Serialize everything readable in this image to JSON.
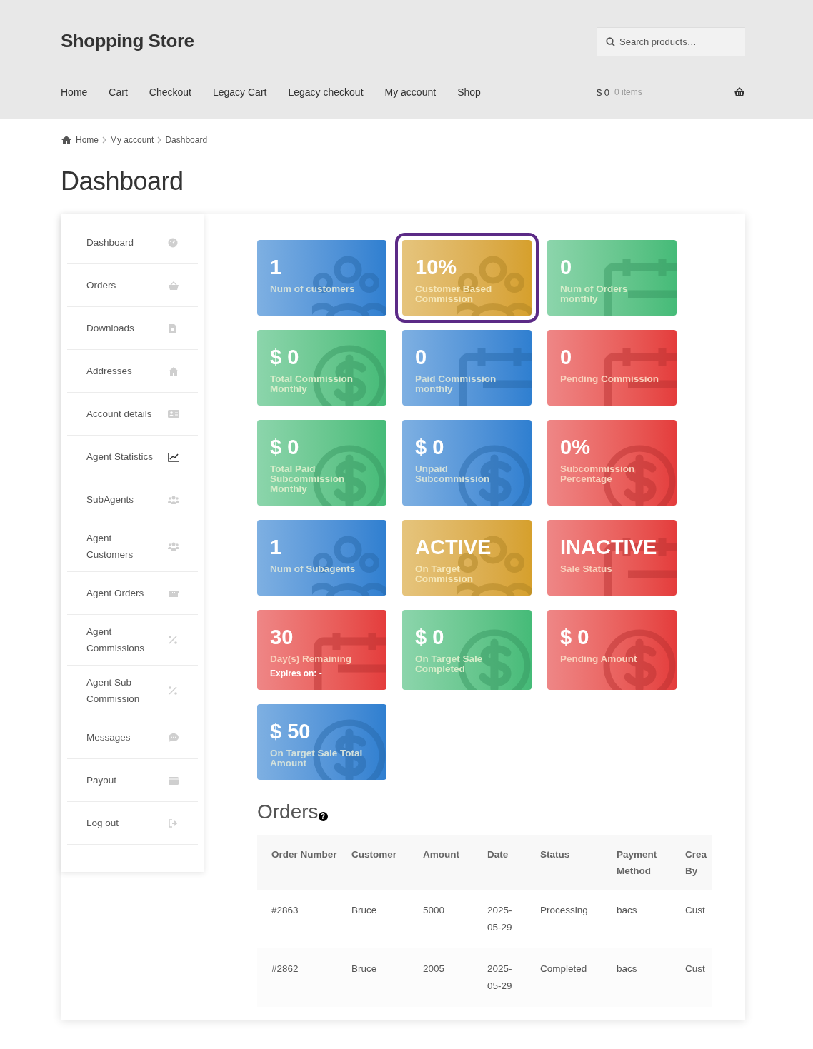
{
  "header": {
    "site_title": "Shopping Store",
    "search": {
      "placeholder": "Search products…"
    },
    "nav": [
      {
        "label": "Home"
      },
      {
        "label": "Cart"
      },
      {
        "label": "Checkout"
      },
      {
        "label": "Legacy Cart"
      },
      {
        "label": "Legacy checkout"
      },
      {
        "label": "My account"
      },
      {
        "label": "Shop"
      }
    ],
    "cart": {
      "amount": "$ 0",
      "count": "0 items"
    }
  },
  "breadcrumb": [
    {
      "label": "Home",
      "link": true
    },
    {
      "label": "My account",
      "link": true
    },
    {
      "label": "Dashboard",
      "link": false
    }
  ],
  "page_title": "Dashboard",
  "sidebar": {
    "items": [
      {
        "label": "Dashboard",
        "selected": false
      },
      {
        "label": "Orders",
        "selected": false
      },
      {
        "label": "Downloads",
        "selected": false
      },
      {
        "label": "Addresses",
        "selected": false
      },
      {
        "label": "Account details",
        "selected": false
      },
      {
        "label": "Agent Statistics",
        "selected": true
      },
      {
        "label": "SubAgents",
        "selected": false
      },
      {
        "label": "Agent Customers",
        "selected": false
      },
      {
        "label": "Agent Orders",
        "selected": false
      },
      {
        "label": "Agent Commissions",
        "selected": false
      },
      {
        "label": "Agent Sub Commission",
        "selected": false
      },
      {
        "label": "Messages",
        "selected": false
      },
      {
        "label": "Payout",
        "selected": false
      },
      {
        "label": "Log out",
        "selected": false
      }
    ]
  },
  "cards": [
    {
      "value": "1",
      "label": "Num of customers",
      "color": "#2f7fd0",
      "kind": "people",
      "outlined": false
    },
    {
      "value": "10%",
      "label": "Customer Based Commission",
      "color": "#d6a02c",
      "kind": "people",
      "outlined": true
    },
    {
      "value": "0",
      "label": "Num of Orders monthly",
      "color": "#45bb78",
      "kind": "calendar",
      "outlined": false
    },
    {
      "value": "$ 0",
      "label": "Total Commission Monthly",
      "color": "#45bb78",
      "kind": "coin",
      "outlined": false
    },
    {
      "value": "0",
      "label": "Paid Commission monthly",
      "color": "#2f7fd0",
      "kind": "calendar",
      "outlined": false
    },
    {
      "value": "0",
      "label": "Pending Commission",
      "color": "#e43c3c",
      "kind": "calendar",
      "outlined": false
    },
    {
      "value": "$ 0",
      "label": "Total Paid Subcommission Monthly",
      "color": "#45bb78",
      "kind": "coin",
      "outlined": false
    },
    {
      "value": "$ 0",
      "label": "Unpaid Subcommission",
      "color": "#2f7fd0",
      "kind": "coin",
      "outlined": false
    },
    {
      "value": "0%",
      "label": "Subcommission Percentage",
      "color": "#e43c3c",
      "kind": "coin",
      "outlined": false
    },
    {
      "value": "1",
      "label": "Num of Subagents",
      "color": "#2f7fd0",
      "kind": "people",
      "outlined": false
    },
    {
      "value": "ACTIVE",
      "label": "On Target Commission",
      "color": "#d6a02c",
      "kind": "people",
      "outlined": false
    },
    {
      "value": "INACTIVE",
      "label": "Sale Status",
      "color": "#e43c3c",
      "kind": "calendar",
      "outlined": false
    },
    {
      "value": "30",
      "label": "Day(s) Remaining",
      "note": "Expires on: -",
      "color": "#e43c3c",
      "kind": "calendar",
      "outlined": false
    },
    {
      "value": "$ 0",
      "label": "On Target Sale Completed",
      "color": "#45bb78",
      "kind": "coin",
      "outlined": false
    },
    {
      "value": "$ 0",
      "label": "Pending Amount",
      "color": "#e43c3c",
      "kind": "coin",
      "outlined": false
    },
    {
      "value": "$ 50",
      "label": "On Target Sale Total Amount",
      "color": "#2f7fd0",
      "kind": "coin",
      "outlined": false
    }
  ],
  "orders": {
    "title": "Orders",
    "help_mark": "?",
    "columns": [
      "Order Number",
      "Customer",
      "Amount",
      "Date",
      "Status",
      "Payment Method",
      "Crea By"
    ],
    "rows": [
      [
        "#2863",
        "Bruce",
        "5000",
        "2025-05-29",
        "Processing",
        "bacs",
        "Cust"
      ],
      [
        "#2862",
        "Bruce",
        "2005",
        "2025-05-29",
        "Completed",
        "bacs",
        "Cust"
      ]
    ]
  }
}
